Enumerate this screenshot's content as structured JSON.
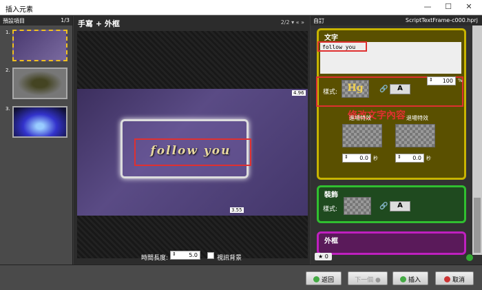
{
  "window": {
    "title": "插入元素",
    "minimize": "—",
    "maximize": "☐",
    "close": "✕"
  },
  "left": {
    "title": "預設項目",
    "count": "1/3",
    "items": [
      "1.",
      "2.",
      "3."
    ]
  },
  "center": {
    "title": "手寫 + 外框",
    "page": "2/2",
    "nav": "▾ « »",
    "preview_text": "follow you",
    "tag_top": "4.96",
    "tag_bottom": "3.55",
    "duration_label": "時間長度:",
    "duration_value": "5.0",
    "bg_label": "視訊背景"
  },
  "right": {
    "title": "自訂",
    "file": "ScriptTextFrame-c000.hprj",
    "text_panel": {
      "header": "文字",
      "input": "follow you",
      "style_label": "樣式:",
      "style_icon": "Hg",
      "color_icon": "A",
      "percent_value": "100",
      "percent_unit": "%",
      "annotation": "修改文字內容",
      "effect_in": "進場特效",
      "effect_out": "退場特效",
      "in_value": "0.0",
      "out_value": "0.0",
      "unit": "秒"
    },
    "deco_panel": {
      "header": "裝飾",
      "style_label": "樣式:",
      "color_icon": "A"
    },
    "frame_panel": {
      "header": "外框"
    },
    "favorites": "0"
  },
  "buttons": {
    "back": "返回",
    "next": "下一個",
    "insert": "插入",
    "cancel": "取消"
  },
  "colors": {
    "text_panel": "#5a5000",
    "text_border": "#c8b400",
    "deco_panel": "#1f4a1f",
    "deco_border": "#30c030",
    "frame_panel": "#5a1a5a",
    "frame_border": "#c020c0",
    "highlight": "#e03030"
  }
}
